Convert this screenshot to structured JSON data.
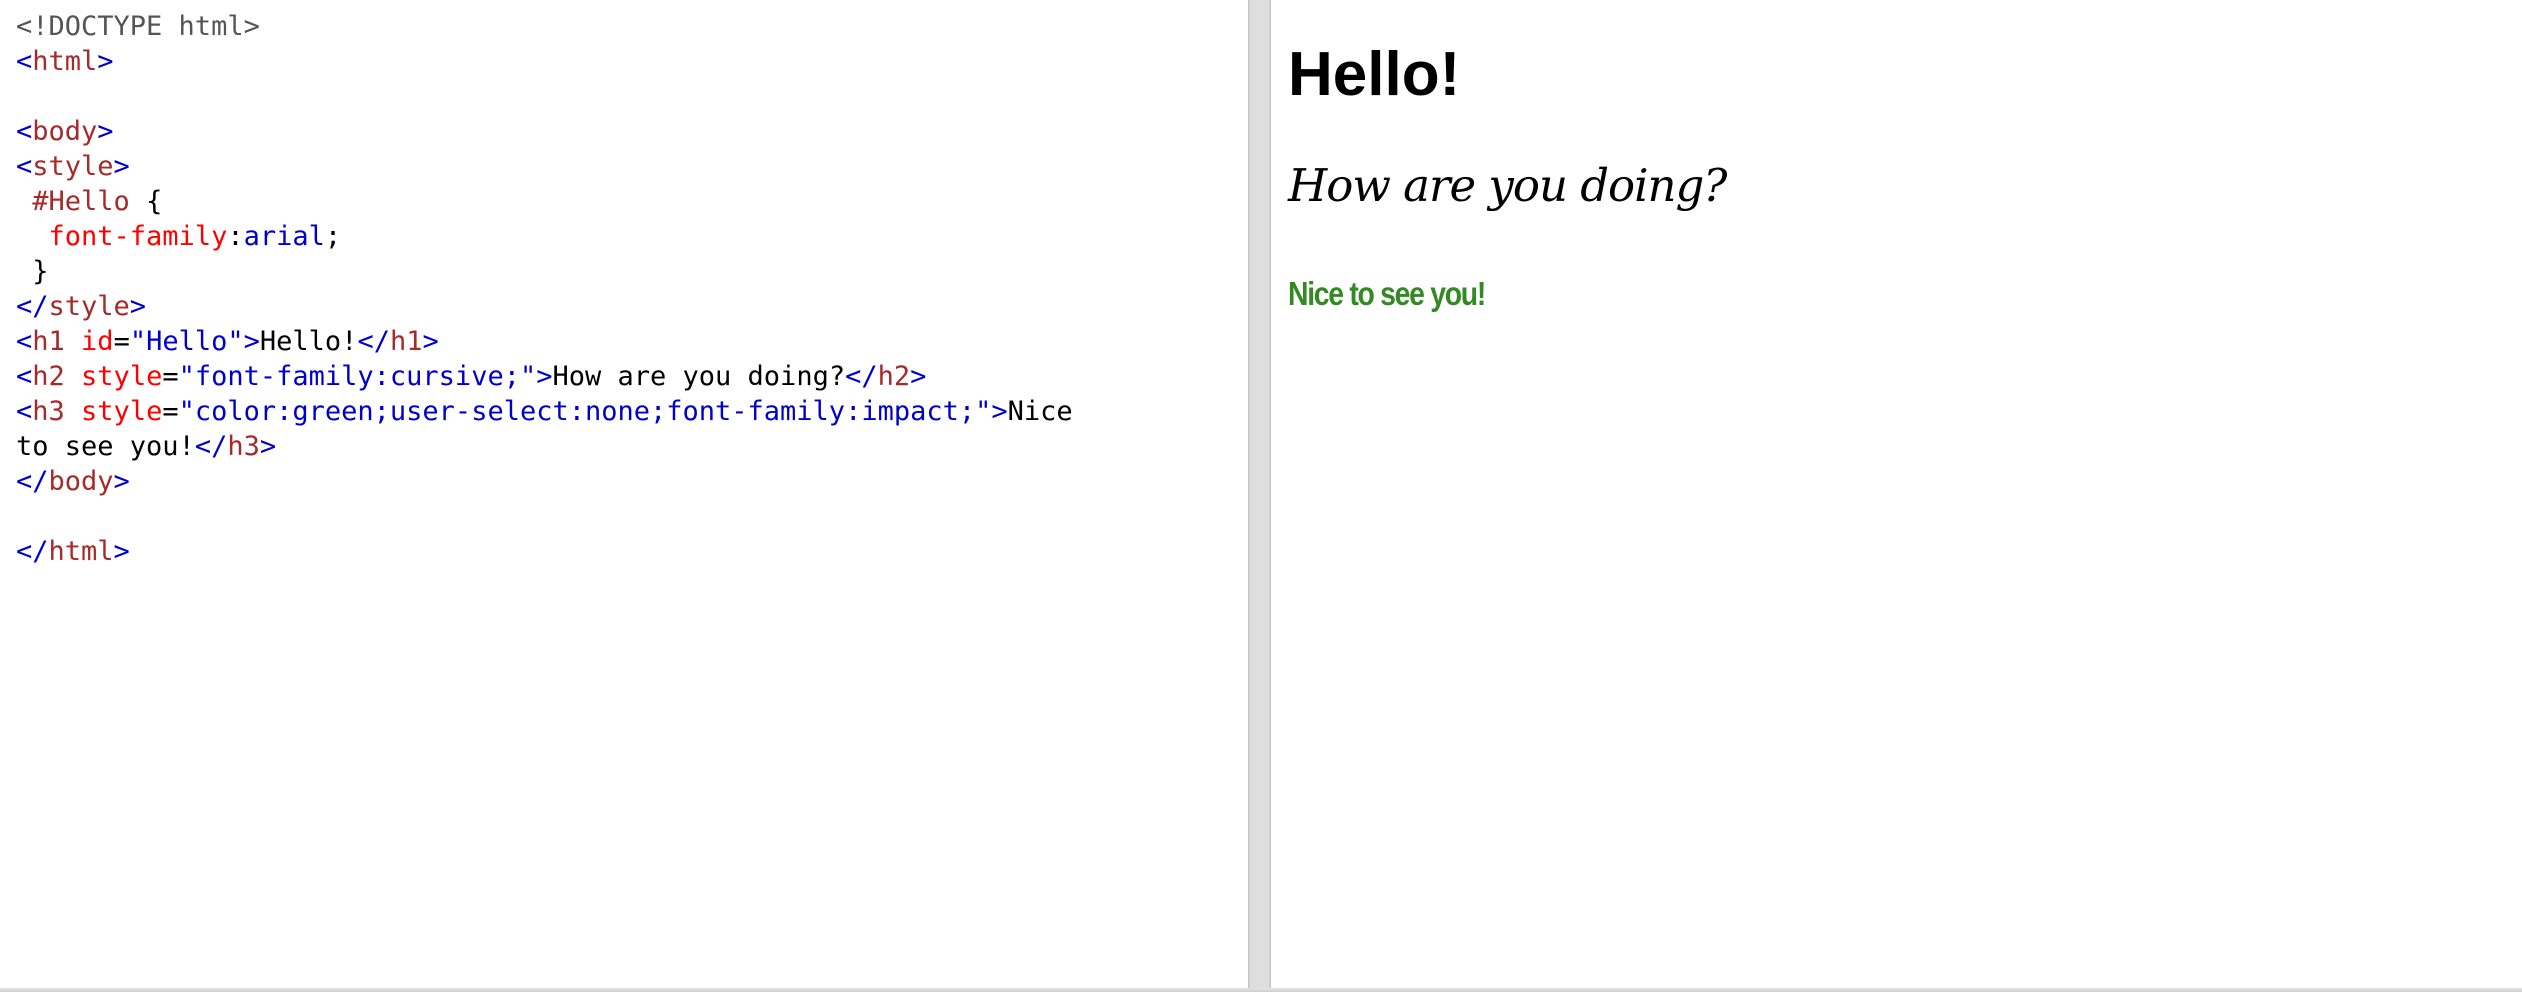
{
  "editor": {
    "lines": [
      [
        {
          "t": "doctype",
          "v": "<!DOCTYPE html>"
        }
      ],
      [
        {
          "t": "bracket",
          "v": "<"
        },
        {
          "t": "tag",
          "v": "html"
        },
        {
          "t": "bracket",
          "v": ">"
        }
      ],
      [],
      [
        {
          "t": "bracket",
          "v": "<"
        },
        {
          "t": "tag",
          "v": "body"
        },
        {
          "t": "bracket",
          "v": ">"
        }
      ],
      [
        {
          "t": "bracket",
          "v": "<"
        },
        {
          "t": "tag",
          "v": "style"
        },
        {
          "t": "bracket",
          "v": ">"
        }
      ],
      [
        {
          "t": "plain",
          "v": " "
        },
        {
          "t": "sel",
          "v": "#Hello"
        },
        {
          "t": "plain",
          "v": " {"
        }
      ],
      [
        {
          "t": "plain",
          "v": "  "
        },
        {
          "t": "prop",
          "v": "font-family"
        },
        {
          "t": "plain",
          "v": ":"
        },
        {
          "t": "propval",
          "v": "arial"
        },
        {
          "t": "plain",
          "v": ";"
        }
      ],
      [
        {
          "t": "plain",
          "v": " }"
        }
      ],
      [
        {
          "t": "bracket",
          "v": "</"
        },
        {
          "t": "tag",
          "v": "style"
        },
        {
          "t": "bracket",
          "v": ">"
        }
      ],
      [
        {
          "t": "bracket",
          "v": "<"
        },
        {
          "t": "tag",
          "v": "h1"
        },
        {
          "t": "plain",
          "v": " "
        },
        {
          "t": "attr",
          "v": "id"
        },
        {
          "t": "plain",
          "v": "="
        },
        {
          "t": "val",
          "v": "\"Hello\""
        },
        {
          "t": "bracket",
          "v": ">"
        },
        {
          "t": "text",
          "v": "Hello!"
        },
        {
          "t": "bracket",
          "v": "</"
        },
        {
          "t": "tag",
          "v": "h1"
        },
        {
          "t": "bracket",
          "v": ">"
        }
      ],
      [
        {
          "t": "bracket",
          "v": "<"
        },
        {
          "t": "tag",
          "v": "h2"
        },
        {
          "t": "plain",
          "v": " "
        },
        {
          "t": "attr",
          "v": "style"
        },
        {
          "t": "plain",
          "v": "="
        },
        {
          "t": "val",
          "v": "\"font-family:cursive;\""
        },
        {
          "t": "bracket",
          "v": ">"
        },
        {
          "t": "text",
          "v": "How are you doing?"
        },
        {
          "t": "bracket",
          "v": "</"
        },
        {
          "t": "tag",
          "v": "h2"
        },
        {
          "t": "bracket",
          "v": ">"
        }
      ],
      [
        {
          "t": "bracket",
          "v": "<"
        },
        {
          "t": "tag",
          "v": "h3"
        },
        {
          "t": "plain",
          "v": " "
        },
        {
          "t": "attr",
          "v": "style"
        },
        {
          "t": "plain",
          "v": "="
        },
        {
          "t": "val",
          "v": "\"color:green;user-select:none;font-family:impact;\""
        },
        {
          "t": "bracket",
          "v": ">"
        },
        {
          "t": "text",
          "v": "Nice"
        }
      ],
      [
        {
          "t": "text",
          "v": "to see you!"
        },
        {
          "t": "bracket",
          "v": "</"
        },
        {
          "t": "tag",
          "v": "h3"
        },
        {
          "t": "bracket",
          "v": ">"
        }
      ],
      [
        {
          "t": "bracket",
          "v": "</"
        },
        {
          "t": "tag",
          "v": "body"
        },
        {
          "t": "bracket",
          "v": ">"
        }
      ],
      [],
      [
        {
          "t": "bracket",
          "v": "</"
        },
        {
          "t": "tag",
          "v": "html"
        },
        {
          "t": "bracket",
          "v": ">"
        }
      ]
    ]
  },
  "result": {
    "h1": "Hello!",
    "h2": "How are you doing?",
    "h3": "Nice to see you!",
    "h3_color": "#338a23"
  }
}
